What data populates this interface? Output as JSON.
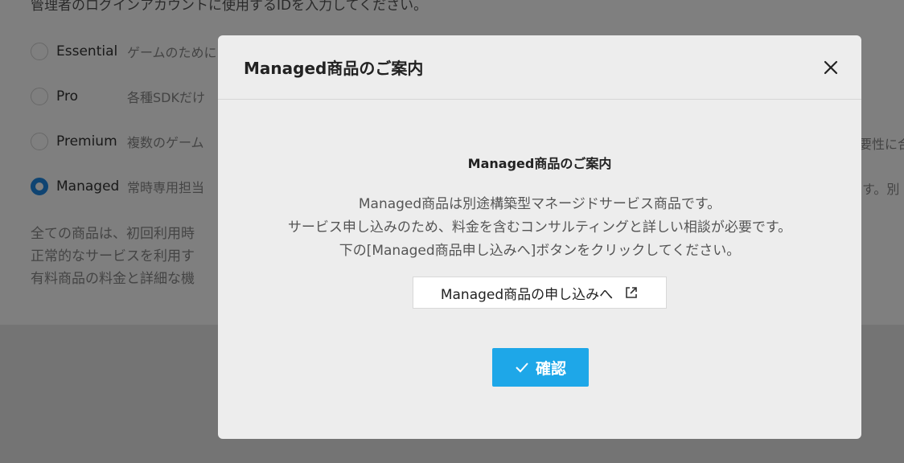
{
  "background": {
    "top_text": "管理者のログインアカウントに使用するIDを入力してください。",
    "plans": [
      {
        "name": "Essential",
        "desc": "ゲームのために",
        "selected": false
      },
      {
        "name": "Pro",
        "desc": "各種SDKだけ",
        "selected": false
      },
      {
        "name": "Premium",
        "desc": "複数のゲーム",
        "selected": false,
        "right_text": "要性に合"
      },
      {
        "name": "Managed",
        "desc": "常時専用担当",
        "selected": true,
        "right_text": "す。別"
      }
    ],
    "notes": [
      "全ての商品は、初回利用時",
      "正常的なサービスを利用す",
      "有料商品の料金と詳細な機"
    ]
  },
  "modal": {
    "title": "Managed商品のご案内",
    "body_title": "Managed商品のご案内",
    "body_lines": [
      "Managed商品は別途構築型マネージドサービス商品です。",
      "サービス申し込みのため、料金を含むコンサルティングと詳しい相談が必要です。",
      "下の[Managed商品申し込みへ]ボタンをクリックしてください。"
    ],
    "apply_button_label": "Managed商品の申し込みへ",
    "confirm_button_label": "確認",
    "accent_color": "#1ea7e8"
  }
}
